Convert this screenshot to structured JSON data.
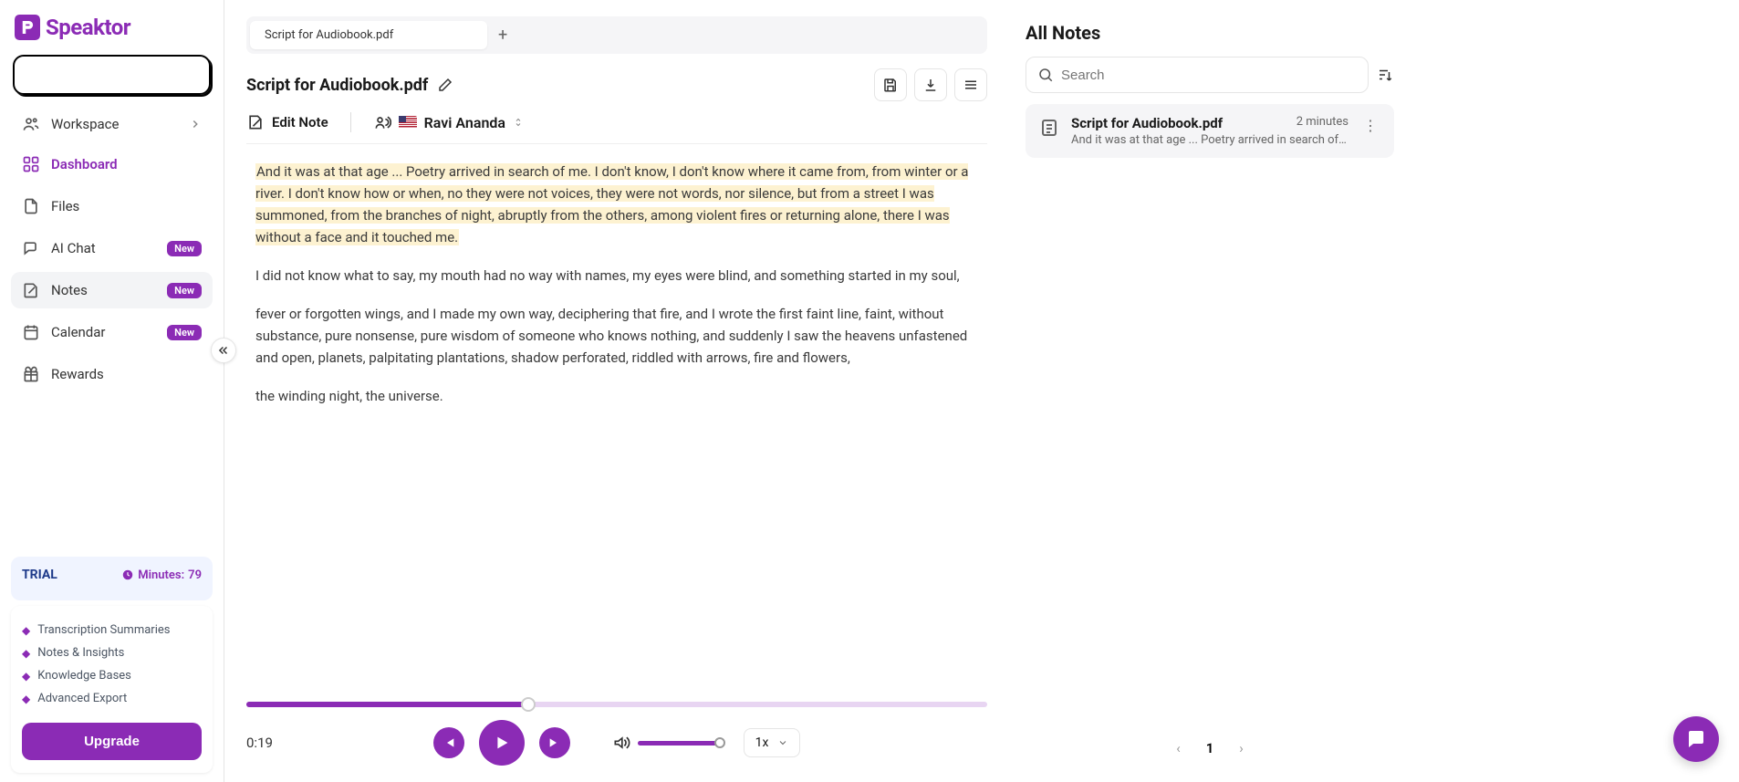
{
  "brand": "Speaktor",
  "sidebar": {
    "workspace": "Workspace",
    "items": [
      {
        "label": "Dashboard"
      },
      {
        "label": "Files"
      },
      {
        "label": "AI Chat",
        "badge": "New"
      },
      {
        "label": "Notes",
        "badge": "New"
      },
      {
        "label": "Calendar",
        "badge": "New"
      },
      {
        "label": "Rewards"
      }
    ]
  },
  "trial": {
    "label": "TRIAL",
    "minutes_label": "Minutes:",
    "minutes_value": "79",
    "features": [
      "Transcription Summaries",
      "Notes & Insights",
      "Knowledge Bases",
      "Advanced Export"
    ],
    "upgrade": "Upgrade"
  },
  "tabs": [
    {
      "label": "Script for Audiobook.pdf"
    }
  ],
  "doc": {
    "title": "Script for Audiobook.pdf",
    "edit_note": "Edit Note",
    "voice_name": "Ravi Ananda"
  },
  "content": {
    "p1_hl": "And it was at that age ... Poetry arrived in search of me. I don't know, I don't know where it came from, from winter or a river. I don't know how or when, no they were not voices, they were not words, nor silence, but from a street I was summoned, from the branches of night, abruptly from the others, among violent fires or returning alone, there I was without a face and it touched me.",
    "p2": "I did not know what to say, my mouth had no way with names, my eyes were blind, and something started in my soul,",
    "p3": "fever or forgotten wings, and I made my own way, deciphering that fire, and I wrote the first faint line, faint, without substance, pure nonsense, pure wisdom of someone who knows nothing, and suddenly I saw the heavens unfastened and open, planets, palpitating plantations, shadow perforated, riddled with arrows, fire and flowers,",
    "p4": "the winding night, the universe."
  },
  "player": {
    "time": "0:19",
    "speed": "1x"
  },
  "notes_panel": {
    "title": "All Notes",
    "search_placeholder": "Search",
    "items": [
      {
        "name": "Script for Audiobook.pdf",
        "time": "2 minutes",
        "preview": "And it was at that age ... Poetry arrived in search of m…"
      }
    ],
    "page": "1"
  }
}
